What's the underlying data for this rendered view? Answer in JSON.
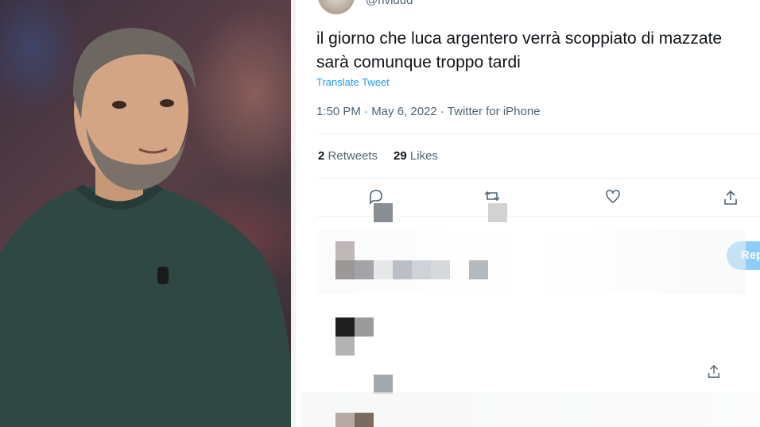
{
  "photo": {
    "icon": "person-photo"
  },
  "tweet": {
    "handle": "@nvidud",
    "text_line1": "il giorno che luca argentero verrà scoppiato di mazzate",
    "text_line2": "sarà comunque troppo tardi",
    "translate_label": "Translate Tweet",
    "meta": "1:50 PM · May 6, 2022 · Twitter for iPhone",
    "retweets_count": "2",
    "retweets_label": "Retweets",
    "likes_count": "29",
    "likes_label": "Likes",
    "reply_button_label": "Reply"
  },
  "colors": {
    "link": "#1d9bf0",
    "text": "#0f1419",
    "muted": "#536471",
    "reply_button": "#8ecdf7"
  },
  "icons": [
    "reply-icon",
    "retweet-icon",
    "like-icon",
    "share-icon"
  ]
}
